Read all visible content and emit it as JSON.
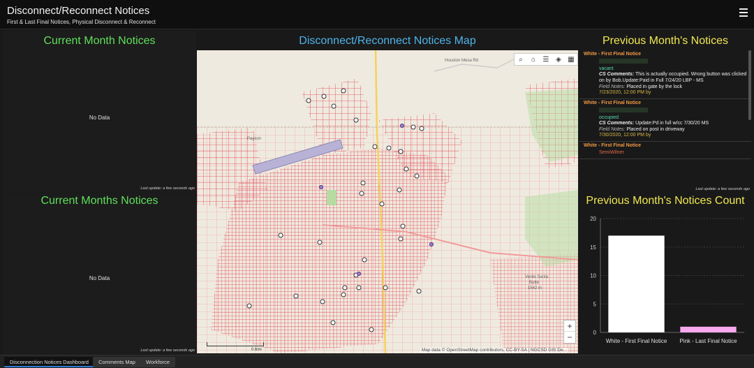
{
  "header": {
    "title": "Disconnect/Reconnect Notices",
    "subtitle": "First & Last Final Notices, Physical Disconnect & Reconnect"
  },
  "panels": {
    "current_month": {
      "title": "Current Month Notices",
      "no_data": "No Data",
      "last_update": "Last update: a few seconds ago"
    },
    "current_months": {
      "title": "Current Months Notices",
      "no_data": "No Data",
      "last_update": "Last update: a few seconds ago"
    },
    "map": {
      "title": "Disconnect/Reconnect Notices Map",
      "attribution": "Map data © OpenStreetMap contributors, CC-BY-SA | NGCSD GIS De...",
      "scale_label": "0.6mi",
      "labels": {
        "payson": "Payson",
        "butte": "Verde Santa",
        "butte2": "Butte",
        "butte3": "1542 m",
        "road": "Houston Mesa Rd"
      }
    },
    "previous_list": {
      "title": "Previous Month's Notices",
      "last_update": "Last update: a few seconds ago",
      "entries": [
        {
          "type": "White - First Final Notice",
          "status": "vacant",
          "cs_label": "CS Comments:",
          "cs_text": "This is actually occupied. Wrong button was clicked on by Bob.Update:Paid in Full 7/24/20 LBP - MS",
          "field_label": "Field Notes:",
          "field_text": "Placed in gate by the lock",
          "date": "7/23/2020, 12:00 PM by"
        },
        {
          "type": "White - First Final Notice",
          "status": "occupied",
          "cs_label": "CS Comments:",
          "cs_text": "Update:Pd in full w/cc 7/30/20 MS",
          "field_label": "Field Notes:",
          "field_text": "Placed on post in driveway",
          "date": "7/30/2020, 12:00 PM by"
        },
        {
          "type": "White - First Final Notice",
          "partial": "SemiWilner"
        }
      ]
    },
    "previous_count": {
      "title": "Previous Month's Notices Count"
    }
  },
  "chart_data": {
    "type": "bar",
    "categories": [
      "White - First Final Notice",
      "Pink - Last Final Notice"
    ],
    "values": [
      17,
      1
    ],
    "colors": [
      "#ffffff",
      "#f7a8ee"
    ],
    "ylim": [
      0,
      20
    ],
    "yticks": [
      0,
      5,
      10,
      15,
      20
    ]
  },
  "tabs": [
    {
      "label": "Disconnection Notices Dashboard",
      "active": true
    },
    {
      "label": "Comments Map",
      "active": false
    },
    {
      "label": "Workforce",
      "active": false
    }
  ],
  "icons": {
    "menu": "hamburger-menu-icon",
    "search": "search-icon",
    "home": "home-icon",
    "legend": "legend-icon",
    "layers": "layers-icon",
    "basemap": "basemap-icon"
  }
}
